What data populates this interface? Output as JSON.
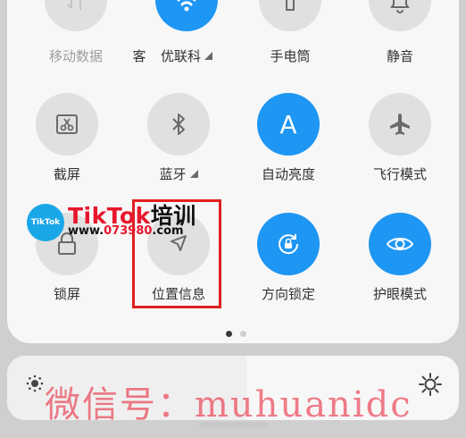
{
  "tiles": [
    {
      "label": "移动数据",
      "icon": "mobile-data-icon",
      "on": false,
      "dim": true
    },
    {
      "label": "客",
      "icon": "",
      "on": false,
      "dim": false
    },
    {
      "label": "优联科",
      "icon": "wifi-icon",
      "on": true,
      "dim": false,
      "expandable": true
    },
    {
      "label": "手电筒",
      "icon": "flashlight-icon",
      "on": false,
      "dim": false
    },
    {
      "label": "静音",
      "icon": "bell-icon",
      "on": false,
      "dim": false
    },
    {
      "label": "截屏",
      "icon": "screenshot-icon",
      "on": false,
      "dim": false
    },
    {
      "label": "蓝牙",
      "icon": "bluetooth-icon",
      "on": false,
      "dim": false,
      "expandable": true
    },
    {
      "label": "自动亮度",
      "icon": "auto-brightness-icon",
      "on": true,
      "dim": false
    },
    {
      "label": "飞行模式",
      "icon": "airplane-icon",
      "on": false,
      "dim": false
    },
    {
      "label": "锁屏",
      "icon": "lock-icon",
      "on": false,
      "dim": false
    },
    {
      "label": "位置信息",
      "icon": "location-icon",
      "on": false,
      "dim": false
    },
    {
      "label": "方向锁定",
      "icon": "rotation-lock-icon",
      "on": true,
      "dim": false
    },
    {
      "label": "护眼模式",
      "icon": "eye-icon",
      "on": true,
      "dim": false
    }
  ],
  "auto_brightness_letter": "A",
  "pager": {
    "pages": 2,
    "current": 1
  },
  "brightness": {
    "level": 0.53
  },
  "watermark": {
    "logo_text": "TikTok",
    "title_latin": "TikTok",
    "title_cn": "培训",
    "url_prefix": "www.",
    "url_number": "073980",
    "url_suffix": ".com",
    "bottom_text": "微信号：muhuanidc"
  },
  "colors": {
    "accent": "#1e96f3",
    "highlight_box": "#e02020"
  }
}
